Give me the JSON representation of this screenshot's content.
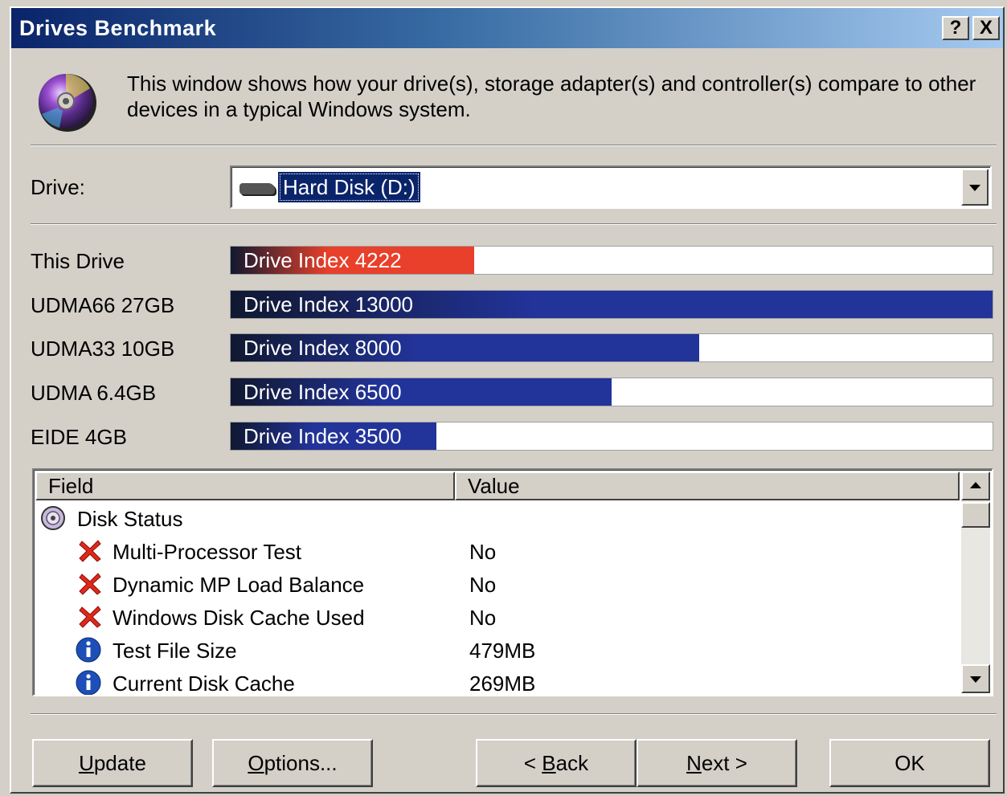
{
  "window": {
    "title": "Drives Benchmark",
    "help_label": "?",
    "close_label": "X"
  },
  "intro": {
    "text": "This window shows how your drive(s), storage adapter(s) and controller(s) compare to other devices in a typical Windows system.",
    "icon": "cd-disc-icon"
  },
  "drive_selector": {
    "label": "Drive:",
    "value": "Hard Disk (D:)",
    "icon": "hard-disk-icon"
  },
  "benchmarks": [
    {
      "label": "This Drive",
      "bar_text": "Drive Index 4222",
      "index": 4222,
      "fill": 0.32,
      "color": "#e8402a"
    },
    {
      "label": "UDMA66 27GB",
      "bar_text": "Drive Index 13000",
      "index": 13000,
      "fill": 1.0,
      "color": "#22339a"
    },
    {
      "label": "UDMA33 10GB",
      "bar_text": "Drive Index 8000",
      "index": 8000,
      "fill": 0.615,
      "color": "#22339a"
    },
    {
      "label": "UDMA 6.4GB",
      "bar_text": "Drive Index 6500",
      "index": 6500,
      "fill": 0.5,
      "color": "#22339a"
    },
    {
      "label": "EIDE 4GB",
      "bar_text": "Drive Index 3500",
      "index": 3500,
      "fill": 0.27,
      "color": "#22339a"
    }
  ],
  "details": {
    "columns": {
      "field": "Field",
      "value": "Value"
    },
    "group": {
      "label": "Disk Status",
      "icon": "disk-status-icon"
    },
    "rows": [
      {
        "field": "Multi-Processor Test",
        "value": "No",
        "icon": "red-x-icon"
      },
      {
        "field": "Dynamic MP Load Balance",
        "value": "No",
        "icon": "red-x-icon"
      },
      {
        "field": "Windows Disk Cache Used",
        "value": "No",
        "icon": "red-x-icon"
      },
      {
        "field": "Test File Size",
        "value": "479MB",
        "icon": "info-icon"
      },
      {
        "field": "Current Disk Cache",
        "value": "269MB",
        "icon": "info-icon"
      }
    ]
  },
  "buttons": {
    "update": {
      "mnemonic": "U",
      "rest": "pdate"
    },
    "options": {
      "mnemonic": "O",
      "rest": "ptions..."
    },
    "back": {
      "prefix": "< ",
      "mnemonic": "B",
      "rest": "ack"
    },
    "next": {
      "mnemonic": "N",
      "rest": "ext >"
    },
    "ok": "OK"
  },
  "colors": {
    "title_gradient_start": "#0a246a",
    "selection": "#0a246a",
    "this_drive_bar": "#e8402a",
    "reference_bar": "#22339a"
  }
}
